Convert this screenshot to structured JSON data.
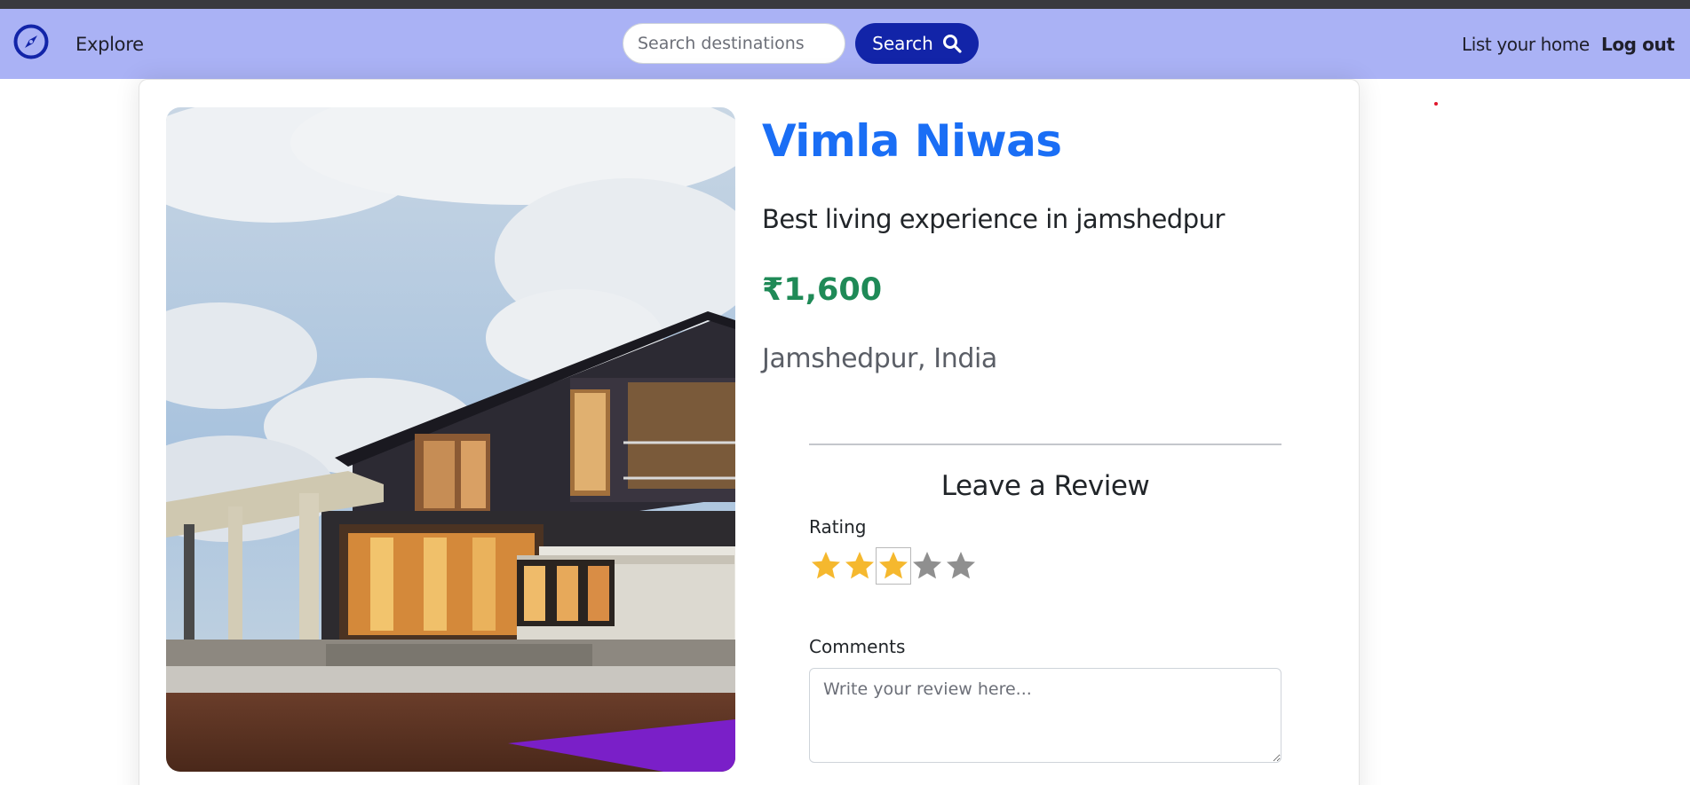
{
  "navbar": {
    "brand_icon": "compass-icon",
    "explore": "Explore",
    "search_placeholder": "Search destinations",
    "search_label": "Search",
    "search_icon": "magnifier-icon",
    "list_home": "List your home",
    "logout": "Log out"
  },
  "listing": {
    "title": "Vimla Niwas",
    "description": "Best living experience in jamshedpur",
    "price": "₹1,600",
    "location": "Jamshedpur, India"
  },
  "review": {
    "heading": "Leave a Review",
    "rating_label": "Rating",
    "rating_value": 3,
    "rating_max": 5,
    "comments_label": "Comments",
    "comments_placeholder": "Write your review here..."
  },
  "colors": {
    "navbar_bg": "#aab2f5",
    "search_button": "#1224a8",
    "title": "#1a6ef5",
    "price": "#1f8a57",
    "star_filled": "#f5b82e",
    "star_empty": "#8f8f8f"
  }
}
